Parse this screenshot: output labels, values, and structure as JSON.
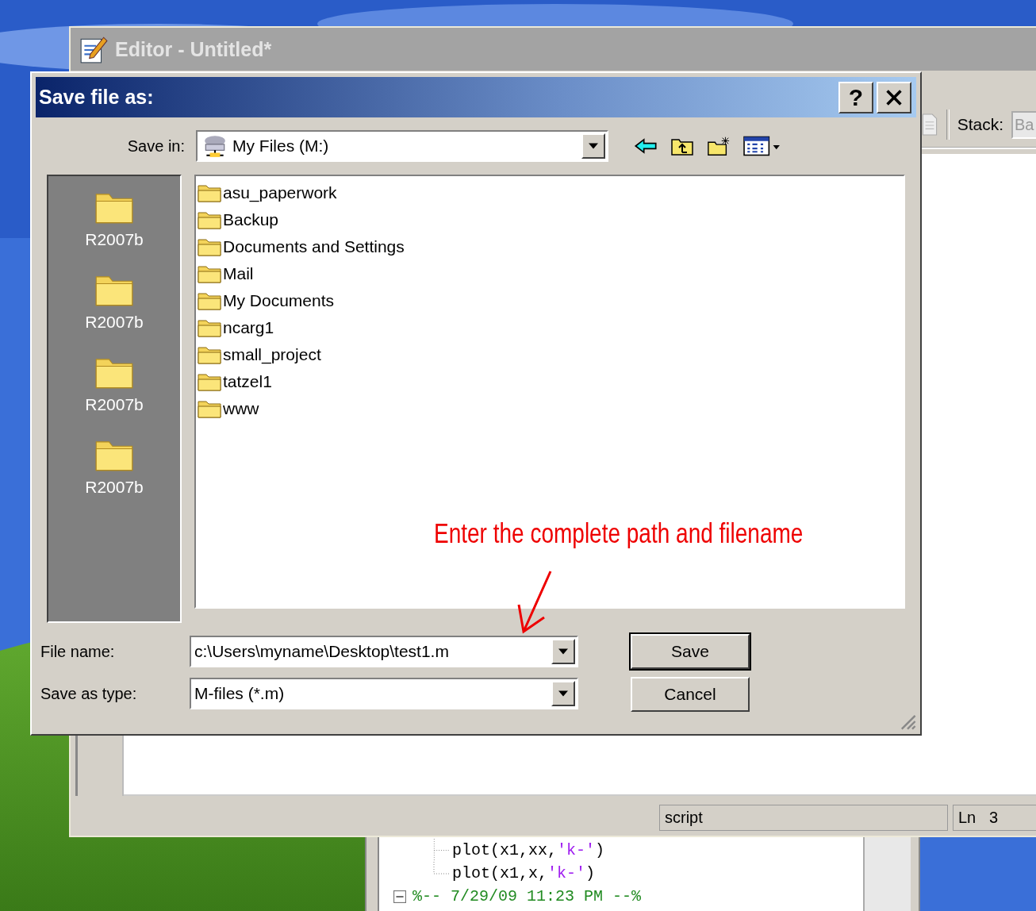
{
  "editor": {
    "title": "Editor - Untitled*",
    "stack_label": "Stack:",
    "stack_value": "Ba",
    "status": {
      "mode": "script",
      "line_label": "Ln",
      "line": "3"
    }
  },
  "dialog": {
    "title": "Save file as:",
    "help": "?",
    "save_in": {
      "label": "Save in:",
      "value": "My Files (M:)"
    },
    "places": [
      {
        "label": "R2007b"
      },
      {
        "label": "R2007b"
      },
      {
        "label": "R2007b"
      },
      {
        "label": "R2007b"
      }
    ],
    "files": [
      "asu_paperwork",
      "Backup",
      "Documents and Settings",
      "Mail",
      "My Documents",
      "ncarg1",
      "small_project",
      "tatzel1",
      "www"
    ],
    "annotation": "Enter the complete path and filename",
    "file_name": {
      "label": "File name:",
      "value": "c:\\Users\\myname\\Desktop\\test1.m"
    },
    "file_type": {
      "label": "Save as type:",
      "value": "M-files (*.m)"
    },
    "buttons": [
      "Save",
      "Cancel"
    ]
  },
  "history": [
    {
      "kind": "call",
      "last": false,
      "parts": [
        {
          "kind": "plain",
          "text": "plot(x1,xx,"
        },
        {
          "kind": "string",
          "text": "'k-'"
        },
        {
          "kind": "plain",
          "text": ")"
        }
      ]
    },
    {
      "kind": "call",
      "last": true,
      "parts": [
        {
          "kind": "plain",
          "text": "plot(x1,x,"
        },
        {
          "kind": "string",
          "text": "'k-'"
        },
        {
          "kind": "plain",
          "text": ")"
        }
      ]
    },
    {
      "kind": "session",
      "expanded": true,
      "parts": [
        {
          "kind": "comment",
          "text": "%-- 7/29/09 11:23 PM --%"
        }
      ]
    }
  ]
}
